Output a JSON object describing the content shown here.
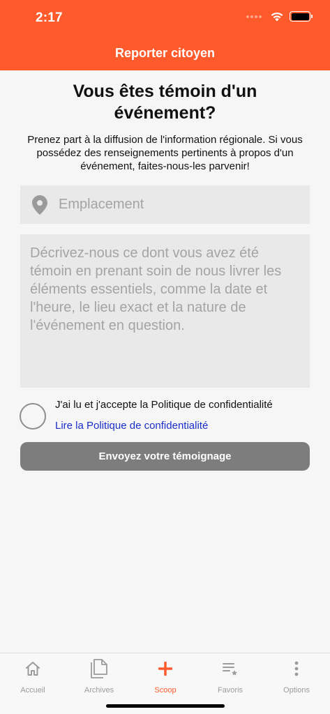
{
  "status_bar": {
    "time": "2:17"
  },
  "header": {
    "title": "Reporter citoyen"
  },
  "main": {
    "title": "Vous êtes témoin d'un événement?",
    "intro": "Prenez part à la diffusion de l'information régionale. Si vous possédez des renseignements pertinents à propos d'un événement, faites-nous-les parvenir!",
    "location": {
      "placeholder": "Emplacement",
      "value": ""
    },
    "description": {
      "placeholder": "Décrivez-nous ce dont vous avez été témoin en prenant soin de nous livrer les éléments essentiels, comme la date et l'heure, le lieu exact et la nature de l'événement en question.",
      "value": ""
    },
    "consent": {
      "label": "J'ai lu et j'accepte la Politique de confidentialité",
      "link": "Lire la Politique de confidentialité",
      "checked": false
    },
    "submit_label": "Envoyez votre témoignage"
  },
  "tabbar": {
    "items": [
      {
        "label": "Accueil",
        "icon": "home-icon"
      },
      {
        "label": "Archives",
        "icon": "documents-icon"
      },
      {
        "label": "Scoop",
        "icon": "plus-icon"
      },
      {
        "label": "Favoris",
        "icon": "list-star-icon"
      },
      {
        "label": "Options",
        "icon": "more-vertical-icon"
      }
    ],
    "active_index": 2
  },
  "colors": {
    "brand": "#ff5a2c",
    "link": "#1a2ecc",
    "button_disabled": "#7d7d7d",
    "field_bg": "#e9e9e9"
  }
}
